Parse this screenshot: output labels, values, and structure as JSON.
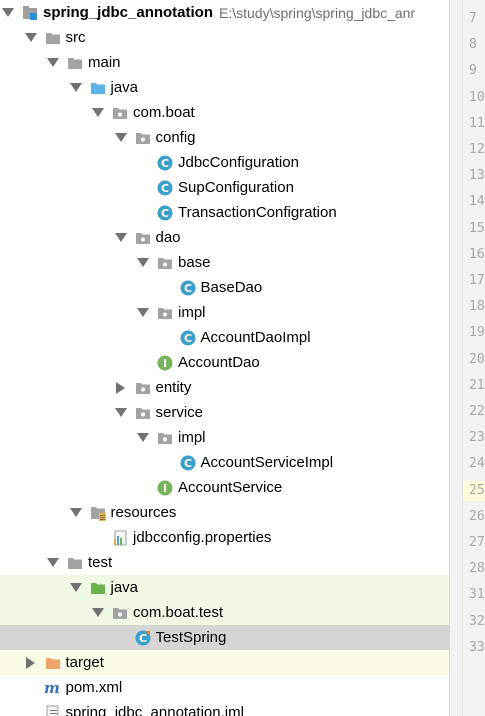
{
  "project_tree": {
    "root": {
      "name": "spring_jdbc_annotation",
      "path": "E:\\study\\spring\\spring_jdbc_anr"
    },
    "nodes": {
      "src": "src",
      "main": "main",
      "java_main": "java",
      "pkg_main": "com.boat",
      "config": "config",
      "jdbc_configuration": "JdbcConfiguration",
      "sup_configuration": "SupConfiguration",
      "transaction_configration": "TransactionConfigration",
      "dao": "dao",
      "base": "base",
      "base_dao": "BaseDao",
      "dao_impl": "impl",
      "account_dao_impl": "AccountDaoImpl",
      "account_dao": "AccountDao",
      "entity": "entity",
      "service": "service",
      "service_impl": "impl",
      "account_service_impl": "AccountServiceImpl",
      "account_service": "AccountService",
      "resources": "resources",
      "jdbcconfig": "jdbcconfig.properties",
      "test": "test",
      "java_test": "java",
      "pkg_test": "com.boat.test",
      "test_spring": "TestSpring",
      "target": "target",
      "pom": "pom.xml",
      "iml": "spring_jdbc_annotation.iml"
    }
  },
  "gutter": {
    "line_numbers": [
      "7",
      "8",
      "9",
      "10",
      "11",
      "12",
      "13",
      "14",
      "15",
      "16",
      "17",
      "18",
      "19",
      "20",
      "21",
      "22",
      "23",
      "24",
      "25",
      "26",
      "27",
      "28",
      "31",
      "32",
      "33"
    ]
  },
  "colors": {
    "selection": "#d5d5d5",
    "test_source_highlight": "#eff7e5",
    "excluded_highlight": "#fbfbe8",
    "class_icon": "#3aa0c9",
    "interface_icon": "#76b35b",
    "folder": "#a3a3a3",
    "source_folder": "#5bb3e8",
    "test_folder": "#6ab04c",
    "excluded_folder": "#f0a46c"
  }
}
